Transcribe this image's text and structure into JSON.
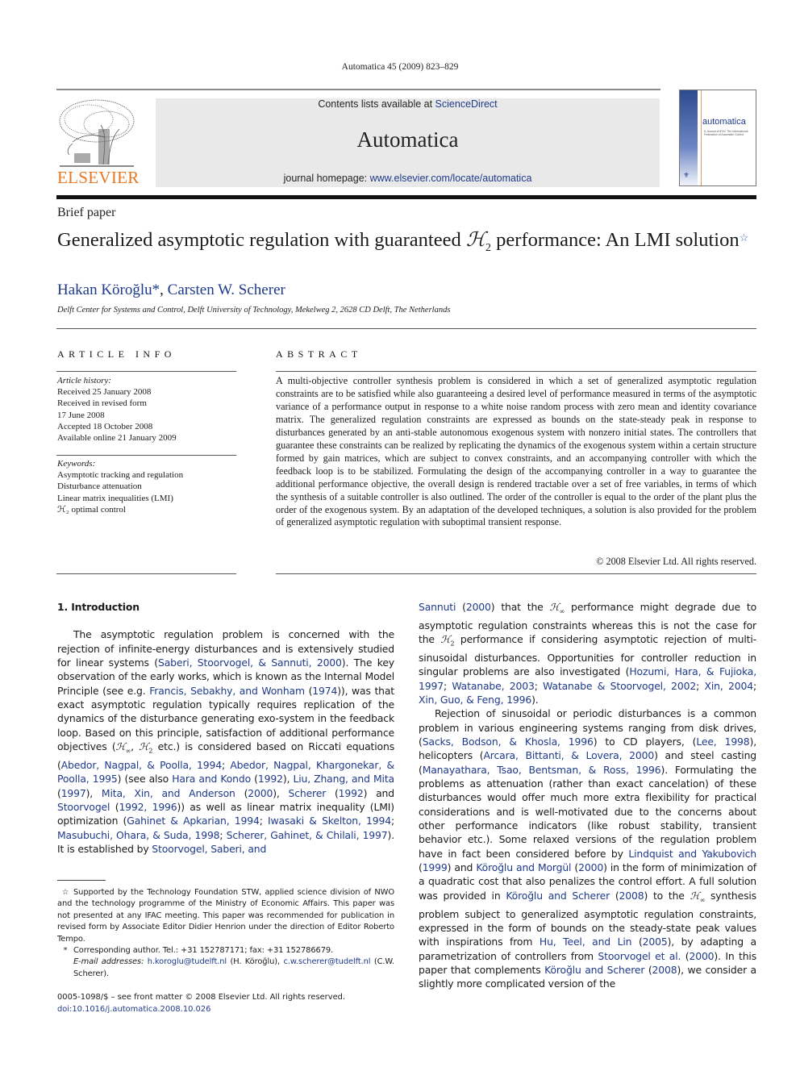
{
  "running_head": "Automatica 45 (2009) 823–829",
  "header": {
    "publisher_logo_text": "ELSEVIER",
    "contents_prefix": "Contents lists available at ",
    "contents_link": "ScienceDirect",
    "journal_name": "Automatica",
    "homepage_prefix": "journal homepage: ",
    "homepage_link": "www.elsevier.com/locate/automatica",
    "cover": {
      "title": "automatica",
      "subtitle": "A Journal of IFAC The International Federation of Automatic Control"
    }
  },
  "colors": {
    "link": "#1f3a8a",
    "elsevier_orange": "#e87722",
    "banner_bg": "#e9e9e9"
  },
  "article": {
    "type": "Brief paper",
    "title_part1": "Generalized asymptotic regulation with guaranteed ",
    "title_math": "ℋ",
    "title_math_sub": "2",
    "title_part2": " performance: An LMI solution",
    "title_footnote_mark": "☆",
    "authors": [
      {
        "name": "Hakan Köroğlu",
        "mark": "*"
      },
      {
        "name": "Carsten W. Scherer",
        "mark": ""
      }
    ],
    "author_separator": ", ",
    "affiliation": "Delft Center for Systems and Control, Delft University of Technology, Mekelweg 2, 2628 CD Delft, The Netherlands"
  },
  "article_info": {
    "heading": "ARTICLE INFO",
    "history_label": "Article history:",
    "history": [
      "Received 25 January 2008",
      "Received in revised form",
      "17 June 2008",
      "Accepted 18 October 2008",
      "Available online 21 January 2009"
    ],
    "keywords_label": "Keywords:",
    "keywords": [
      "Asymptotic tracking and regulation",
      "Disturbance attenuation",
      "Linear matrix inequalities (LMI)",
      "ℋ₂ optimal control"
    ]
  },
  "abstract": {
    "heading": "ABSTRACT",
    "text": "A multi-objective controller synthesis problem is considered in which a set of generalized asymptotic regulation constraints are to be satisfied while also guaranteeing a desired level of performance measured in terms of the asymptotic variance of a performance output in response to a white noise random process with zero mean and identity covariance matrix. The generalized regulation constraints are expressed as bounds on the state-steady peak in response to disturbances generated by an anti-stable autonomous exogenous system with nonzero initial states. The controllers that guarantee these constraints can be realized by replicating the dynamics of the exogenous system within a certain structure formed by gain matrices, which are subject to convex constraints, and an accompanying controller with which the feedback loop is to be stabilized. Formulating the design of the accompanying controller in a way to guarantee the additional performance objective, the overall design is rendered tractable over a set of free variables, in terms of which the synthesis of a suitable controller is also outlined. The order of the controller is equal to the order of the plant plus the order of the exogenous system. By an adaptation of the developed techniques, a solution is also provided for the problem of generalized asymptotic regulation with suboptimal transient response.",
    "copyright": "© 2008 Elsevier Ltd. All rights reserved."
  },
  "introduction": {
    "heading": "1.  Introduction",
    "left_para": [
      {
        "t": "The asymptotic regulation problem is concerned with the rejection of infinite-energy disturbances and is extensively studied for linear systems ("
      },
      {
        "l": "Saberi, Stoorvogel, & Sannuti, 2000"
      },
      {
        "t": "). The key observation of the early works, which is known as the Internal Model Principle (see e.g. "
      },
      {
        "l": "Francis, Sebakhy, and Wonham"
      },
      {
        "t": " ("
      },
      {
        "l": "1974"
      },
      {
        "t": ")), was that exact asymptotic regulation typically requires replication of the dynamics of the disturbance generating exo-system in the feedback loop. Based on this principle, satisfaction of additional performance objectives ("
      },
      {
        "m": "ℋ",
        "s": "∞"
      },
      {
        "t": ", "
      },
      {
        "m": "ℋ",
        "s": "2"
      },
      {
        "t": " etc.) is considered based on Riccati equations ("
      },
      {
        "l": "Abedor, Nagpal, & Poolla, 1994"
      },
      {
        "t": "; "
      },
      {
        "l": "Abedor, Nagpal, Khargonekar, & Poolla, 1995"
      },
      {
        "t": ") (see also "
      },
      {
        "l": "Hara and Kondo"
      },
      {
        "t": " ("
      },
      {
        "l": "1992"
      },
      {
        "t": "), "
      },
      {
        "l": "Liu, Zhang, and Mita"
      },
      {
        "t": " ("
      },
      {
        "l": "1997"
      },
      {
        "t": "), "
      },
      {
        "l": "Mita, Xin, and Anderson"
      },
      {
        "t": " ("
      },
      {
        "l": "2000"
      },
      {
        "t": "), "
      },
      {
        "l": "Scherer"
      },
      {
        "t": " ("
      },
      {
        "l": "1992"
      },
      {
        "t": ") and "
      },
      {
        "l": "Stoorvogel"
      },
      {
        "t": " ("
      },
      {
        "l": "1992, 1996"
      },
      {
        "t": ")) as well as linear matrix inequality (LMI) optimization ("
      },
      {
        "l": "Gahinet & Apkarian, 1994"
      },
      {
        "t": "; "
      },
      {
        "l": "Iwasaki & Skelton, 1994"
      },
      {
        "t": "; "
      },
      {
        "l": "Masubuchi, Ohara, & Suda, 1998"
      },
      {
        "t": "; "
      },
      {
        "l": "Scherer, Gahinet, & Chilali, 1997"
      },
      {
        "t": "). It is established by "
      },
      {
        "l": "Stoorvogel, Saberi, and"
      }
    ],
    "right_para1": [
      {
        "l": "Sannuti"
      },
      {
        "t": " ("
      },
      {
        "l": "2000"
      },
      {
        "t": ") that the "
      },
      {
        "m": "ℋ",
        "s": "∞"
      },
      {
        "t": " performance might degrade due to asymptotic regulation constraints whereas this is not the case for the "
      },
      {
        "m": "ℋ",
        "s": "2"
      },
      {
        "t": " performance if considering asymptotic rejection of multi-sinusoidal disturbances. Opportunities for controller reduction in singular problems are also investigated ("
      },
      {
        "l": "Hozumi, Hara, & Fujioka, 1997"
      },
      {
        "t": "; "
      },
      {
        "l": "Watanabe, 2003"
      },
      {
        "t": "; "
      },
      {
        "l": "Watanabe & Stoorvogel, 2002"
      },
      {
        "t": "; "
      },
      {
        "l": "Xin, 2004"
      },
      {
        "t": "; "
      },
      {
        "l": "Xin, Guo, & Feng, 1996"
      },
      {
        "t": ")."
      }
    ],
    "right_para2": [
      {
        "t": "Rejection of sinusoidal or periodic disturbances is a common problem in various engineering systems ranging from disk drives, ("
      },
      {
        "l": "Sacks, Bodson, & Khosla, 1996"
      },
      {
        "t": ") to CD players, ("
      },
      {
        "l": "Lee, 1998"
      },
      {
        "t": "), helicopters ("
      },
      {
        "l": "Arcara, Bittanti, & Lovera, 2000"
      },
      {
        "t": ") and steel casting ("
      },
      {
        "l": "Manayathara, Tsao, Bentsman, & Ross, 1996"
      },
      {
        "t": "). Formulating the problems as attenuation (rather than exact cancelation) of these disturbances would offer much more extra flexibility for practical considerations and is well-motivated due to the concerns about other performance indicators (like robust stability, transient behavior etc.). Some relaxed versions of the regulation problem have in fact been considered before by "
      },
      {
        "l": "Lindquist and Yakubovich"
      },
      {
        "t": " ("
      },
      {
        "l": "1999"
      },
      {
        "t": ") and "
      },
      {
        "l": "Köroğlu and Morgül"
      },
      {
        "t": " ("
      },
      {
        "l": "2000"
      },
      {
        "t": ") in the form of minimization of a quadratic cost that also penalizes the control effort. A full solution was provided in "
      },
      {
        "l": "Köroğlu and Scherer"
      },
      {
        "t": " ("
      },
      {
        "l": "2008"
      },
      {
        "t": ") to the "
      },
      {
        "m": "ℋ",
        "s": "∞"
      },
      {
        "t": " synthesis problem subject to generalized asymptotic regulation constraints, expressed in the form of bounds on the steady-state peak values with inspirations from "
      },
      {
        "l": "Hu, Teel, and Lin"
      },
      {
        "t": " ("
      },
      {
        "l": "2005"
      },
      {
        "t": "), by adapting a parametrization of controllers from "
      },
      {
        "l": "Stoorvogel et al."
      },
      {
        "t": " ("
      },
      {
        "l": "2000"
      },
      {
        "t": "). In this paper that complements "
      },
      {
        "l": "Köroğlu and Scherer"
      },
      {
        "t": " ("
      },
      {
        "l": "2008"
      },
      {
        "t": "), we consider a slightly more complicated version of the"
      }
    ]
  },
  "footnotes": {
    "funding_mark": "☆",
    "funding": "Supported by the Technology Foundation STW, applied science division of NWO and the technology programme of the Ministry of Economic Affairs. This paper was not presented at any IFAC meeting. This paper was recommended for publication in revised form by Associate Editor Didier Henrion under the direction of Editor Roberto Tempo.",
    "corresponding_mark": "*",
    "corresponding": "Corresponding author. Tel.: +31 152787171; fax: +31 152786679.",
    "email_label": "E-mail addresses:",
    "email1": "h.koroglu@tudelft.nl",
    "email1_owner": " (H. Köroğlu), ",
    "email2": "c.w.scherer@tudelft.nl",
    "email2_owner": " (C.W. Scherer)."
  },
  "front_matter": {
    "issn_line": "0005-1098/$ – see front matter © 2008 Elsevier Ltd. All rights reserved.",
    "doi": "doi:10.1016/j.automatica.2008.10.026"
  }
}
